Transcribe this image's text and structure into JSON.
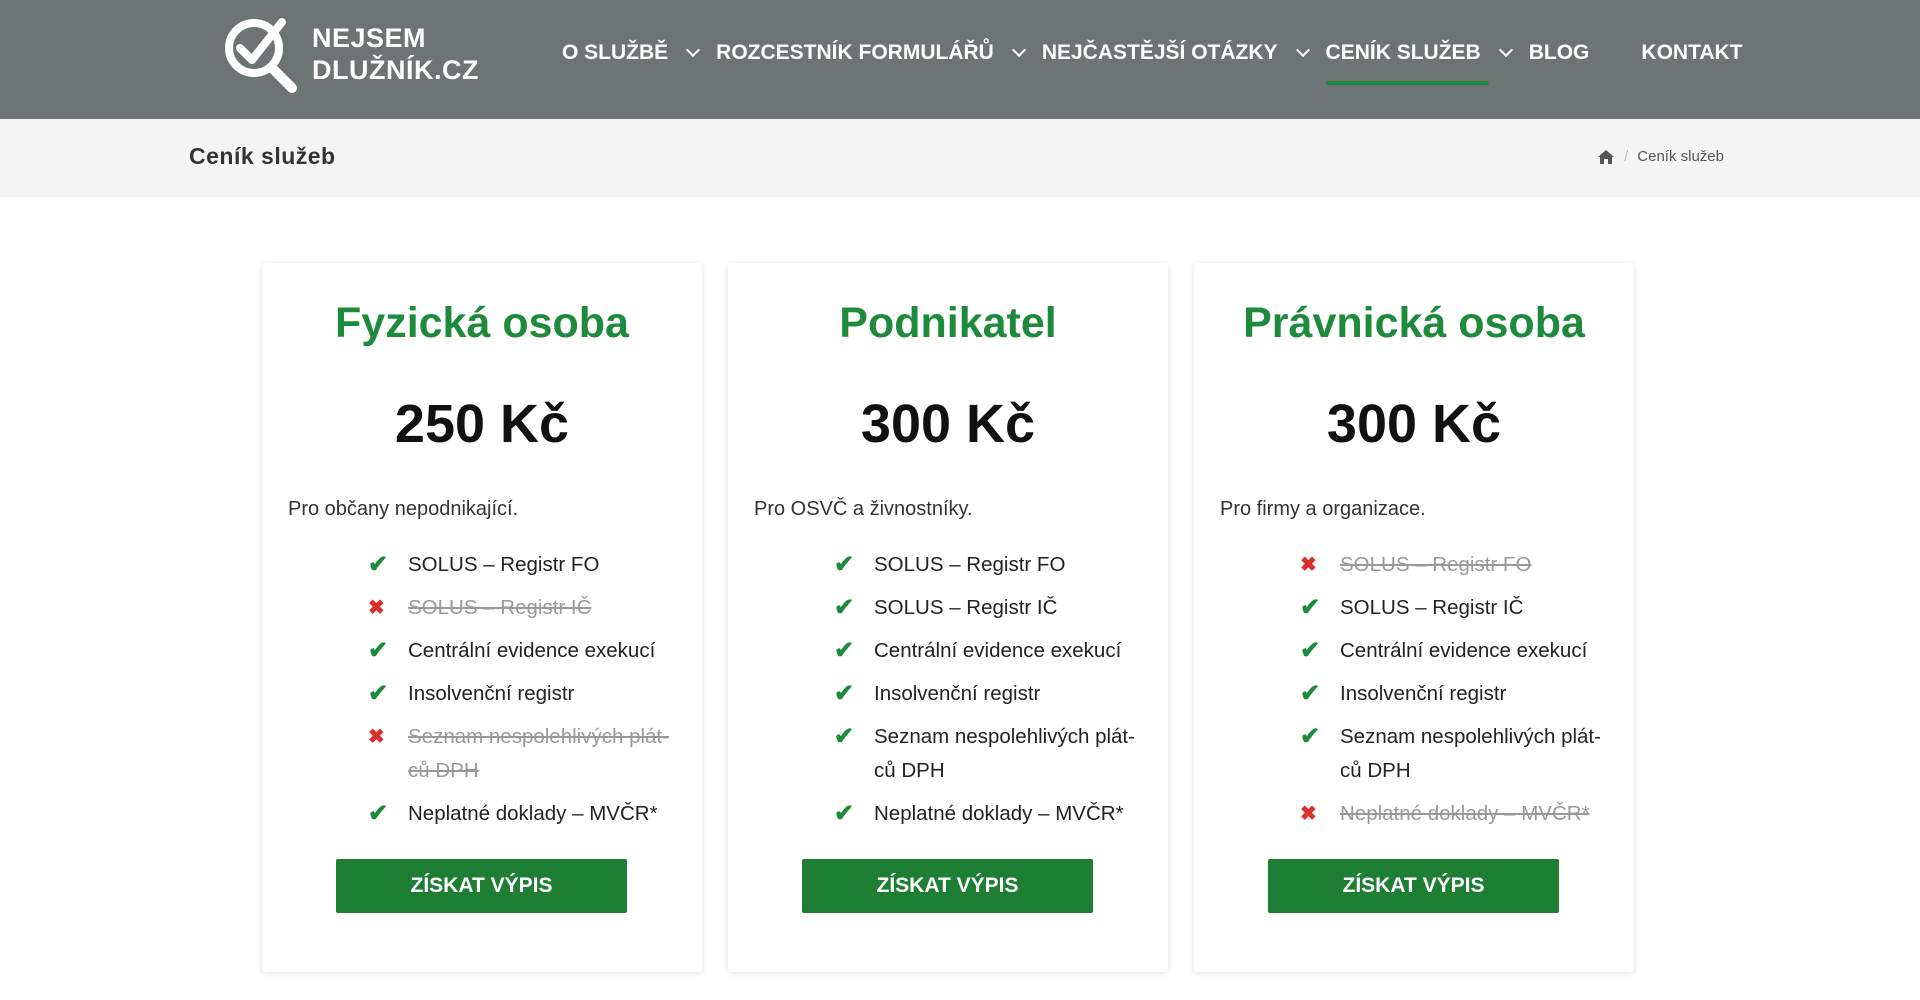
{
  "header": {
    "logo_line1": "NEJSEM",
    "logo_line2": "DLUŽNÍK.CZ",
    "nav": [
      {
        "label": "O SLUŽBĚ"
      },
      {
        "label": "ROZCESTNÍK FORMULÁŘŮ"
      },
      {
        "label": "NEJČASTĚJŠÍ OTÁZKY"
      },
      {
        "label": "CENÍK SLUŽEB"
      },
      {
        "label": "BLOG"
      },
      {
        "label": "KONTAKT"
      }
    ]
  },
  "breadcrumb": {
    "page_title": "Ceník služeb",
    "current": "Ceník služeb"
  },
  "colors": {
    "accent": "#1e8a3c",
    "header_bg": "#6e7375",
    "cross": "#d9302c"
  },
  "cards": [
    {
      "title": "Fyzická osoba",
      "price": "250 Kč",
      "desc": "Pro občany nepodnikající.",
      "features": [
        {
          "text": "SOLUS – Registr FO",
          "included": true
        },
        {
          "text": "SOLUS – Registr IČ",
          "included": false
        },
        {
          "text": "Centrální evidence exekucí",
          "included": true
        },
        {
          "text": "Insolvenční registr",
          "included": true
        },
        {
          "text": "Seznam nespolehlivých plát­ců DPH",
          "included": false
        },
        {
          "text": "Neplatné doklady – MVČR*",
          "included": true
        }
      ],
      "button": "ZÍSKAT VÝPIS"
    },
    {
      "title": "Podnikatel",
      "price": "300 Kč",
      "desc": "Pro OSVČ a živnostníky.",
      "features": [
        {
          "text": "SOLUS – Registr FO",
          "included": true
        },
        {
          "text": "SOLUS – Registr IČ",
          "included": true
        },
        {
          "text": "Centrální evidence exekucí",
          "included": true
        },
        {
          "text": "Insolvenční registr",
          "included": true
        },
        {
          "text": "Seznam nespolehlivých plát­ců DPH",
          "included": true
        },
        {
          "text": "Neplatné doklady – MVČR*",
          "included": true
        }
      ],
      "button": "ZÍSKAT VÝPIS"
    },
    {
      "title": "Právnická osoba",
      "price": "300 Kč",
      "desc": "Pro firmy a organizace.",
      "features": [
        {
          "text": "SOLUS – Registr FO",
          "included": false
        },
        {
          "text": "SOLUS – Registr IČ",
          "included": true
        },
        {
          "text": "Centrální evidence exekucí",
          "included": true
        },
        {
          "text": "Insolvenční registr",
          "included": true
        },
        {
          "text": "Seznam nespolehlivých plát­ců DPH",
          "included": true
        },
        {
          "text": "Neplatné doklady – MVČR*",
          "included": false
        }
      ],
      "button": "ZÍSKAT VÝPIS"
    }
  ]
}
